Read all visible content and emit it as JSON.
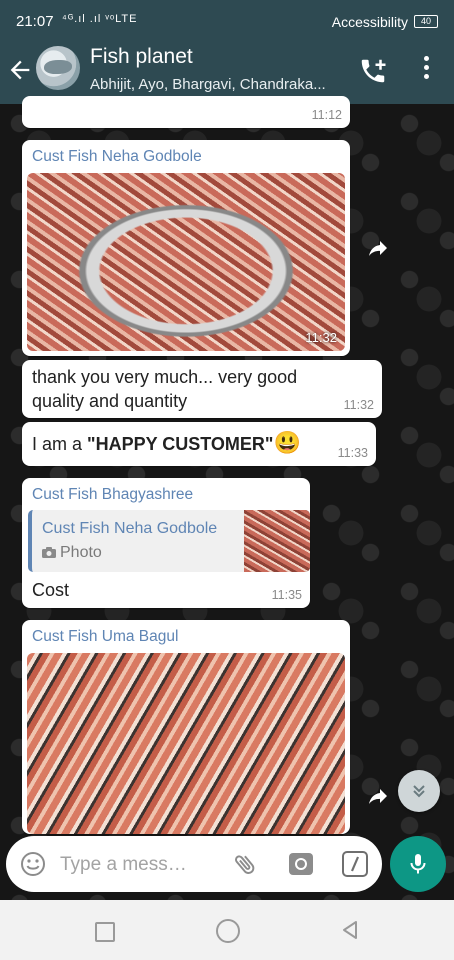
{
  "status_bar": {
    "time": "21:07",
    "signal": "⁴ᴳ.ıl .ıl ᵛᵒLTE",
    "accessibility": "Accessibility",
    "battery": "40"
  },
  "header": {
    "title": "Fish planet",
    "subtitle": "Abhijit, Ayo, Bhargavi, Chandraka..."
  },
  "messages": [
    {
      "time": "11:12"
    },
    {
      "sender": "Cust Fish Neha Godbole",
      "type": "photo",
      "time": "11:32"
    },
    {
      "text": "thank you very much... very good quality and quantity",
      "time": "11:32"
    },
    {
      "text_prefix": "I am a ",
      "text_bold": "\"HAPPY CUSTOMER\"",
      "emoji": "😃",
      "time": "11:33"
    },
    {
      "sender": "Cust Fish Bhagyashree",
      "quote_sender": "Cust Fish Neha Godbole",
      "quote_label": "Photo",
      "text": "Cost",
      "time": "11:35"
    },
    {
      "sender": "Cust Fish Uma Bagul",
      "type": "photo"
    }
  ],
  "input": {
    "placeholder": "Type a mess…"
  },
  "colors": {
    "header": "#2e4a52",
    "accent": "#0d9785",
    "sender_name": "#5f85b4"
  }
}
